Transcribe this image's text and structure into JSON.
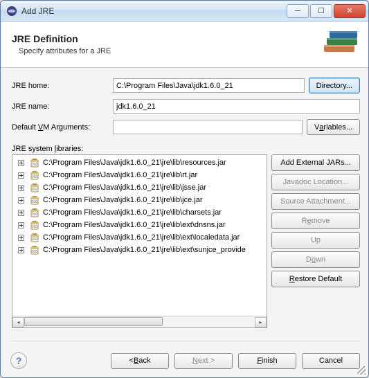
{
  "window": {
    "title": "Add JRE"
  },
  "header": {
    "title": "JRE Definition",
    "subtitle": "Specify attributes for a JRE"
  },
  "form": {
    "jre_home_label": "JRE home:",
    "jre_home_value": "C:\\Program Files\\Java\\jdk1.6.0_21",
    "directory_btn": "Directory...",
    "jre_name_label": "JRE name:",
    "jre_name_value": "jdk1.6.0_21",
    "default_args_label": "Default VM Arguments:",
    "default_args_value": "",
    "variables_btn": "Variables...",
    "libs_label": "JRE system libraries:"
  },
  "libs": [
    "C:\\Program Files\\Java\\jdk1.6.0_21\\jre\\lib\\resources.jar",
    "C:\\Program Files\\Java\\jdk1.6.0_21\\jre\\lib\\rt.jar",
    "C:\\Program Files\\Java\\jdk1.6.0_21\\jre\\lib\\jsse.jar",
    "C:\\Program Files\\Java\\jdk1.6.0_21\\jre\\lib\\jce.jar",
    "C:\\Program Files\\Java\\jdk1.6.0_21\\jre\\lib\\charsets.jar",
    "C:\\Program Files\\Java\\jdk1.6.0_21\\jre\\lib\\ext\\dnsns.jar",
    "C:\\Program Files\\Java\\jdk1.6.0_21\\jre\\lib\\ext\\localedata.jar",
    "C:\\Program Files\\Java\\jdk1.6.0_21\\jre\\lib\\ext\\sunjce_provide"
  ],
  "side_buttons": {
    "add_ext": "Add External JARs...",
    "javadoc": "Javadoc Location...",
    "source": "Source Attachment...",
    "remove": "Remove",
    "up": "Up",
    "down": "Down",
    "restore": "Restore Default"
  },
  "footer": {
    "back": "< Back",
    "next": "Next >",
    "finish": "Finish",
    "cancel": "Cancel"
  }
}
